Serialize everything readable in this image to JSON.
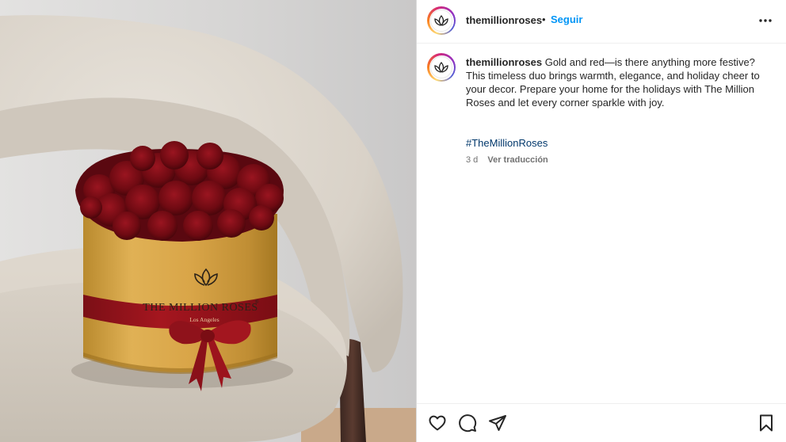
{
  "post": {
    "username": "themillionroses",
    "separator": "•",
    "follow_label": "Seguir",
    "caption_text": "Gold and red—is there anything more festive? This timeless duo brings warmth, elegance, and holiday cheer to your decor. Prepare your home for the holidays with The Million Roses and let every corner sparkle with joy.",
    "hashtag": "#TheMillionRoses",
    "time_ago": "3 d",
    "translate_label": "Ver traducción"
  },
  "photo": {
    "brand_text": "THE MILLION ROSES",
    "registered_mark": "®",
    "subtext": "Los Angeles"
  },
  "icons": {
    "more": "more-options-icon",
    "like": "heart-icon",
    "comment": "comment-icon",
    "share": "send-icon",
    "save": "bookmark-icon"
  },
  "colors": {
    "follow_blue": "#0095f6",
    "hashtag_blue": "#00376b",
    "text_primary": "#262626",
    "text_secondary": "#737373"
  }
}
